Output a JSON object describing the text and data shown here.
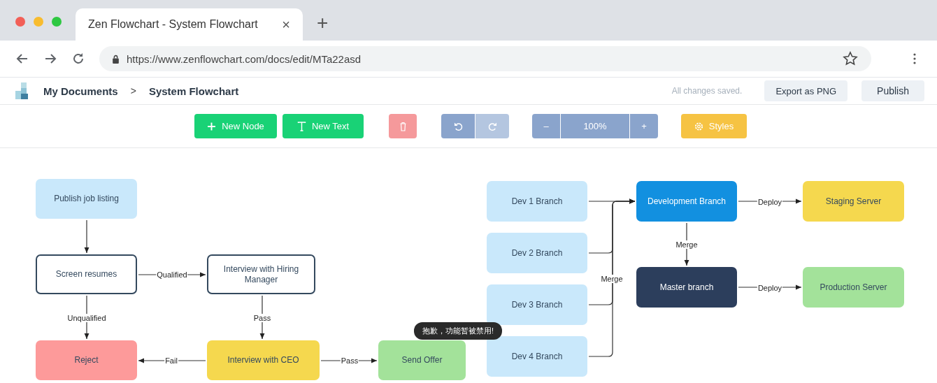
{
  "browser": {
    "tab_title": "Zen Flowchart - System Flowchart",
    "tab_close": "×",
    "new_tab": "+",
    "url": "https://www.zenflowchart.com/docs/edit/MTa22asd"
  },
  "header": {
    "breadcrumbs": [
      "My Documents",
      "System Flowchart"
    ],
    "separator": ">",
    "save_status": "All changes saved.",
    "buttons": [
      "Export as PNG",
      "Publish"
    ]
  },
  "toolbar": {
    "new_node": "New Node",
    "new_text": "New Text",
    "delete_disabled": true,
    "undo_disabled": false,
    "redo_disabled": true,
    "zoom_out": "–",
    "zoom": "100%",
    "zoom_in": "+",
    "styles": "Styles"
  },
  "nodes": [
    {
      "label": "Publish job listing",
      "kind": "filled",
      "color": "#c9e8fb"
    },
    {
      "label": "Screen resumes",
      "kind": "outlined",
      "color": "#ffffff"
    },
    {
      "label": "Interview with Hiring Manager",
      "kind": "outlined",
      "color": "#ffffff"
    },
    {
      "label": "Reject",
      "kind": "filled",
      "color": "#fd9a9a"
    },
    {
      "label": "Interview with CEO",
      "kind": "filled",
      "color": "#f5d84e"
    },
    {
      "label": "Send Offer",
      "kind": "filled",
      "color": "#a3e29a"
    },
    {
      "label": "Dev 1 Branch",
      "kind": "filled",
      "color": "#c9e8fb"
    },
    {
      "label": "Dev 2 Branch",
      "kind": "filled",
      "color": "#c9e8fb"
    },
    {
      "label": "Dev 3 Branch",
      "kind": "filled",
      "color": "#c9e8fb"
    },
    {
      "label": "Dev 4 Branch",
      "kind": "filled",
      "color": "#c9e8fb"
    },
    {
      "label": "Development Branch",
      "kind": "filled",
      "color": "#1290e0"
    },
    {
      "label": "Master branch",
      "kind": "filled",
      "color": "#2c3e5c"
    },
    {
      "label": "Staging Server",
      "kind": "filled",
      "color": "#f5d84e"
    },
    {
      "label": "Production Server",
      "kind": "filled",
      "color": "#a3e29a"
    }
  ],
  "edge_labels": [
    "Qualified",
    "Unqualified",
    "Pass",
    "Fail",
    "Pass",
    "Merge",
    "Merge",
    "Deploy",
    "Deploy"
  ],
  "toast": "抱歉，功能暂被禁用!"
}
